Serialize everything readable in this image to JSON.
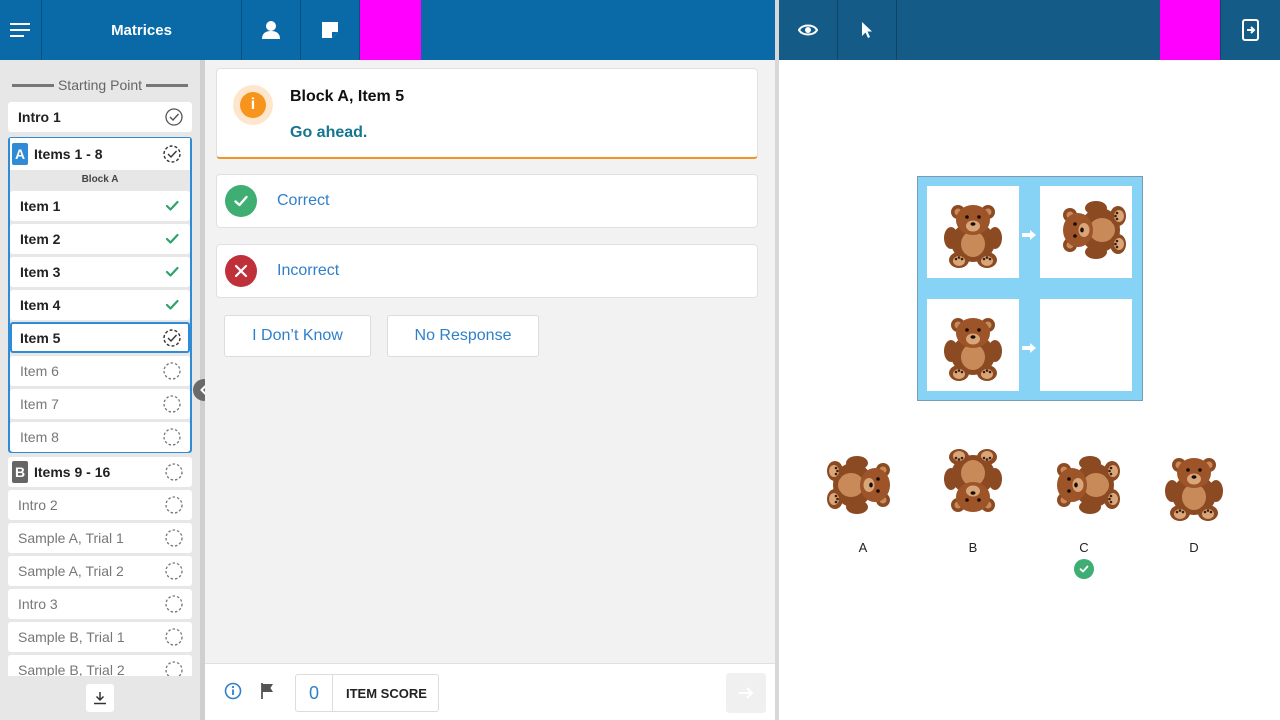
{
  "header": {
    "title": "Matrices"
  },
  "sidebar": {
    "starting_point": "Starting Point",
    "intro1": "Intro 1",
    "blockA": {
      "letter": "A",
      "label": "Items 1 - 8",
      "sublabel": "Block A",
      "items": [
        {
          "label": "Item 1",
          "status": "done"
        },
        {
          "label": "Item 2",
          "status": "done"
        },
        {
          "label": "Item 3",
          "status": "done"
        },
        {
          "label": "Item 4",
          "status": "done"
        },
        {
          "label": "Item 5",
          "status": "current"
        },
        {
          "label": "Item 6",
          "status": "pending"
        },
        {
          "label": "Item 7",
          "status": "pending"
        },
        {
          "label": "Item 8",
          "status": "pending"
        }
      ]
    },
    "blockB": {
      "letter": "B",
      "label": "Items 9 - 16"
    },
    "rest": [
      "Intro 2",
      "Sample A, Trial 1",
      "Sample A, Trial 2",
      "Intro 3",
      "Sample B, Trial 1",
      "Sample B, Trial 2"
    ]
  },
  "main": {
    "info_title": "Block A, Item 5",
    "info_message": "Go ahead.",
    "correct_label": "Correct",
    "incorrect_label": "Incorrect",
    "idk_label": "I Don’t Know",
    "no_response_label": "No Response"
  },
  "footer": {
    "score_value": "0",
    "score_label": "ITEM SCORE"
  },
  "stimulus": {
    "choices": [
      "A",
      "B",
      "C",
      "D"
    ],
    "selected": "C"
  },
  "colors": {
    "topbar_left": "#0a6aa8",
    "topbar_right": "#155b87",
    "highlight": "#ff00ff",
    "accent": "#2f8bd6",
    "correct": "#3fae73",
    "incorrect": "#c0303a",
    "info": "#f7941d",
    "matrix_bg": "#86d3f5"
  },
  "icons": [
    "menu-icon",
    "person-icon",
    "note-icon",
    "eye-icon",
    "pointer-icon",
    "exit-icon",
    "check-icon",
    "circle-check-icon",
    "pending-icon",
    "info-icon",
    "flag-icon",
    "arrow-right-icon",
    "download-icon",
    "chevron-left-icon",
    "close-icon",
    "bear-image"
  ]
}
